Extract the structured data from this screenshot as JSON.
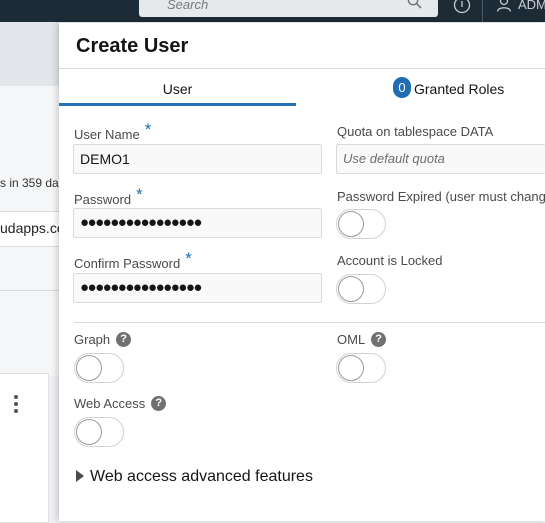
{
  "topbar": {
    "search_placeholder": "Search",
    "user_label": "ADM"
  },
  "background": {
    "text_fragment_1": "s in 359 da",
    "text_fragment_2": "udapps.co"
  },
  "drawer": {
    "title": "Create User",
    "tabs": {
      "user": "User",
      "roles_count": "0",
      "roles": "Granted Roles"
    },
    "fields": {
      "username": {
        "label": "User Name",
        "value": "DEMO1"
      },
      "quota": {
        "label": "Quota on tablespace DATA",
        "placeholder": "Use default quota"
      },
      "password": {
        "label": "Password",
        "value": "●●●●●●●●●●●●●●●●"
      },
      "password_expired": {
        "label": "Password Expired (user must change",
        "on": false
      },
      "confirm_password": {
        "label": "Confirm Password",
        "value": "●●●●●●●●●●●●●●●●"
      },
      "account_locked": {
        "label": "Account is Locked",
        "on": false
      },
      "graph": {
        "label": "Graph",
        "on": false
      },
      "oml": {
        "label": "OML",
        "on": false
      },
      "web_access": {
        "label": "Web Access",
        "on": false
      }
    },
    "required_mark": "*",
    "help_glyph": "?",
    "advanced_features": "Web access advanced features"
  },
  "colors": {
    "accent": "#1f6db3",
    "topbar": "#1c2b36"
  }
}
